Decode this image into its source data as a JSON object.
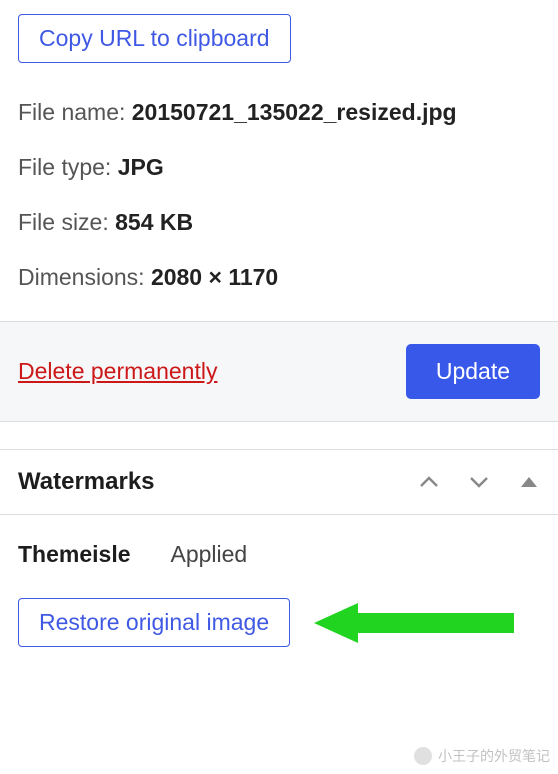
{
  "top": {
    "copy_button": "Copy URL to clipboard",
    "file_name_label": "File name:",
    "file_name_value": "20150721_135022_resized.jpg",
    "file_type_label": "File type:",
    "file_type_value": "JPG",
    "file_size_label": "File size:",
    "file_size_value": "854 KB",
    "dimensions_label": "Dimensions:",
    "dimensions_value": "2080 × 1170"
  },
  "actions": {
    "delete": "Delete permanently",
    "update": "Update"
  },
  "watermarks": {
    "title": "Watermarks",
    "item_name": "Themeisle",
    "item_status": "Applied",
    "restore": "Restore original image"
  },
  "footer": {
    "credit": "小王子的外贸笔记"
  }
}
